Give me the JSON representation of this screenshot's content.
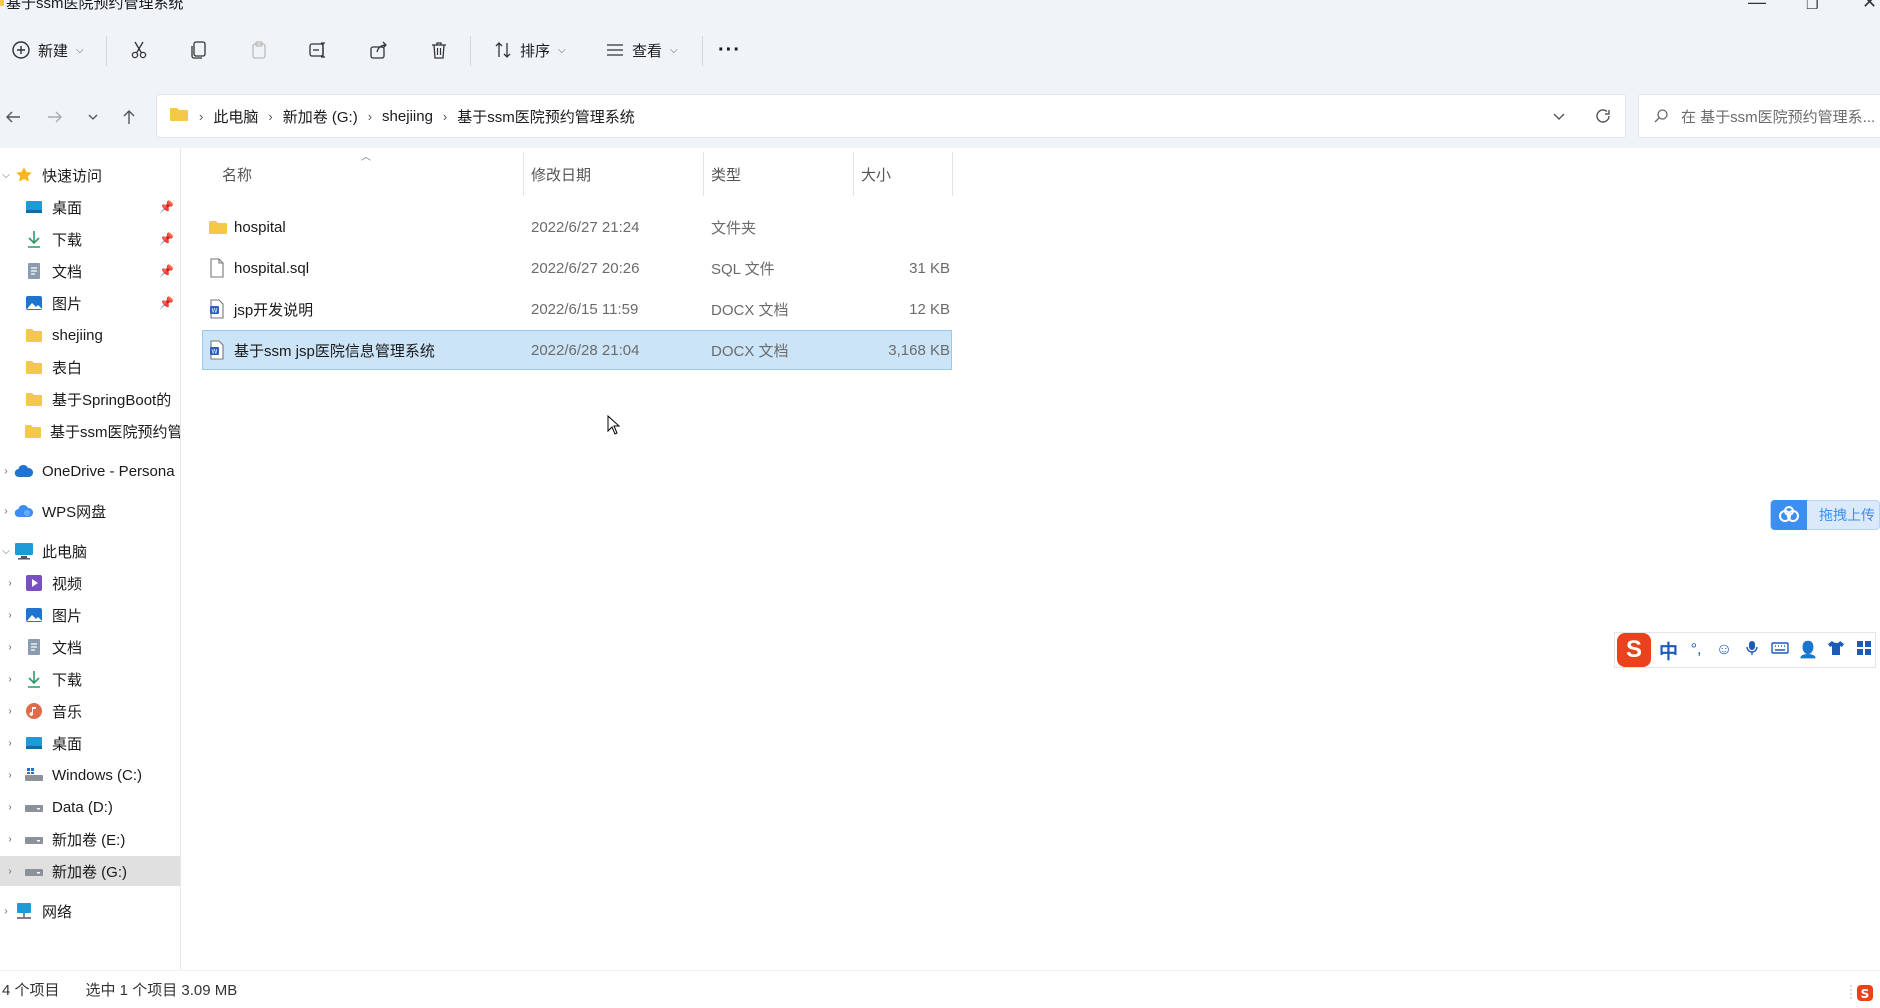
{
  "window": {
    "title": "基于ssm医院预约管理系统",
    "min_glyph": "—",
    "max_glyph": "❐",
    "close_glyph": "✕"
  },
  "toolbar": {
    "new_label": "新建",
    "sort_label": "排序",
    "view_label": "查看",
    "more_glyph": "···"
  },
  "breadcrumb": [
    "此电脑",
    "新加卷 (G:)",
    "shejiing",
    "基于ssm医院预约管理系统"
  ],
  "search": {
    "placeholder": "在 基于ssm医院预约管理系..."
  },
  "sidebar": {
    "quick_access": "快速访问",
    "quick_items": [
      {
        "label": "桌面",
        "icon": "desktop-icon",
        "pinned": true
      },
      {
        "label": "下载",
        "icon": "download-icon",
        "pinned": true
      },
      {
        "label": "文档",
        "icon": "document-icon",
        "pinned": true
      },
      {
        "label": "图片",
        "icon": "pictures-icon",
        "pinned": true
      },
      {
        "label": "shejiing",
        "icon": "folder-icon",
        "pinned": false
      },
      {
        "label": "表白",
        "icon": "folder-icon",
        "pinned": false
      },
      {
        "label": "基于SpringBoot的",
        "icon": "folder-icon",
        "pinned": false
      },
      {
        "label": "基于ssm医院预约管",
        "icon": "folder-icon",
        "pinned": false
      }
    ],
    "onedrive": "OneDrive - Persona",
    "wps": "WPS网盘",
    "this_pc": "此电脑",
    "pc_items": [
      {
        "label": "视频",
        "icon": "video-icon"
      },
      {
        "label": "图片",
        "icon": "pictures-icon"
      },
      {
        "label": "文档",
        "icon": "document-icon"
      },
      {
        "label": "下载",
        "icon": "download-icon"
      },
      {
        "label": "音乐",
        "icon": "music-icon"
      },
      {
        "label": "桌面",
        "icon": "desktop-icon"
      },
      {
        "label": "Windows (C:)",
        "icon": "drive-icon"
      },
      {
        "label": "Data (D:)",
        "icon": "drive-icon"
      },
      {
        "label": "新加卷 (E:)",
        "icon": "drive-icon"
      },
      {
        "label": "新加卷 (G:)",
        "icon": "drive-icon"
      }
    ],
    "network": "网络"
  },
  "columns": {
    "name": "名称",
    "modified": "修改日期",
    "type": "类型",
    "size": "大小"
  },
  "files": [
    {
      "name": "hospital",
      "modified": "2022/6/27 21:24",
      "type": "文件夹",
      "size": "",
      "icon": "folder-icon"
    },
    {
      "name": "hospital.sql",
      "modified": "2022/6/27 20:26",
      "type": "SQL 文件",
      "size": "31 KB",
      "icon": "file-icon"
    },
    {
      "name": "jsp开发说明",
      "modified": "2022/6/15 11:59",
      "type": "DOCX 文档",
      "size": "12 KB",
      "icon": "docx-icon"
    },
    {
      "name": "基于ssm jsp医院信息管理系统",
      "modified": "2022/6/28 21:04",
      "type": "DOCX 文档",
      "size": "3,168 KB",
      "icon": "docx-icon"
    }
  ],
  "cloud_widget": {
    "label": "拖拽上传"
  },
  "ime": {
    "lang": "中",
    "punct": "°,",
    "logo": "S"
  },
  "status": {
    "count": "4 个项目",
    "selection": "选中 1 个项目  3.09 MB"
  },
  "colors": {
    "selected_row": "#cce4f7",
    "accent": "#3c8ef0",
    "ime_brand": "#e8431c"
  }
}
